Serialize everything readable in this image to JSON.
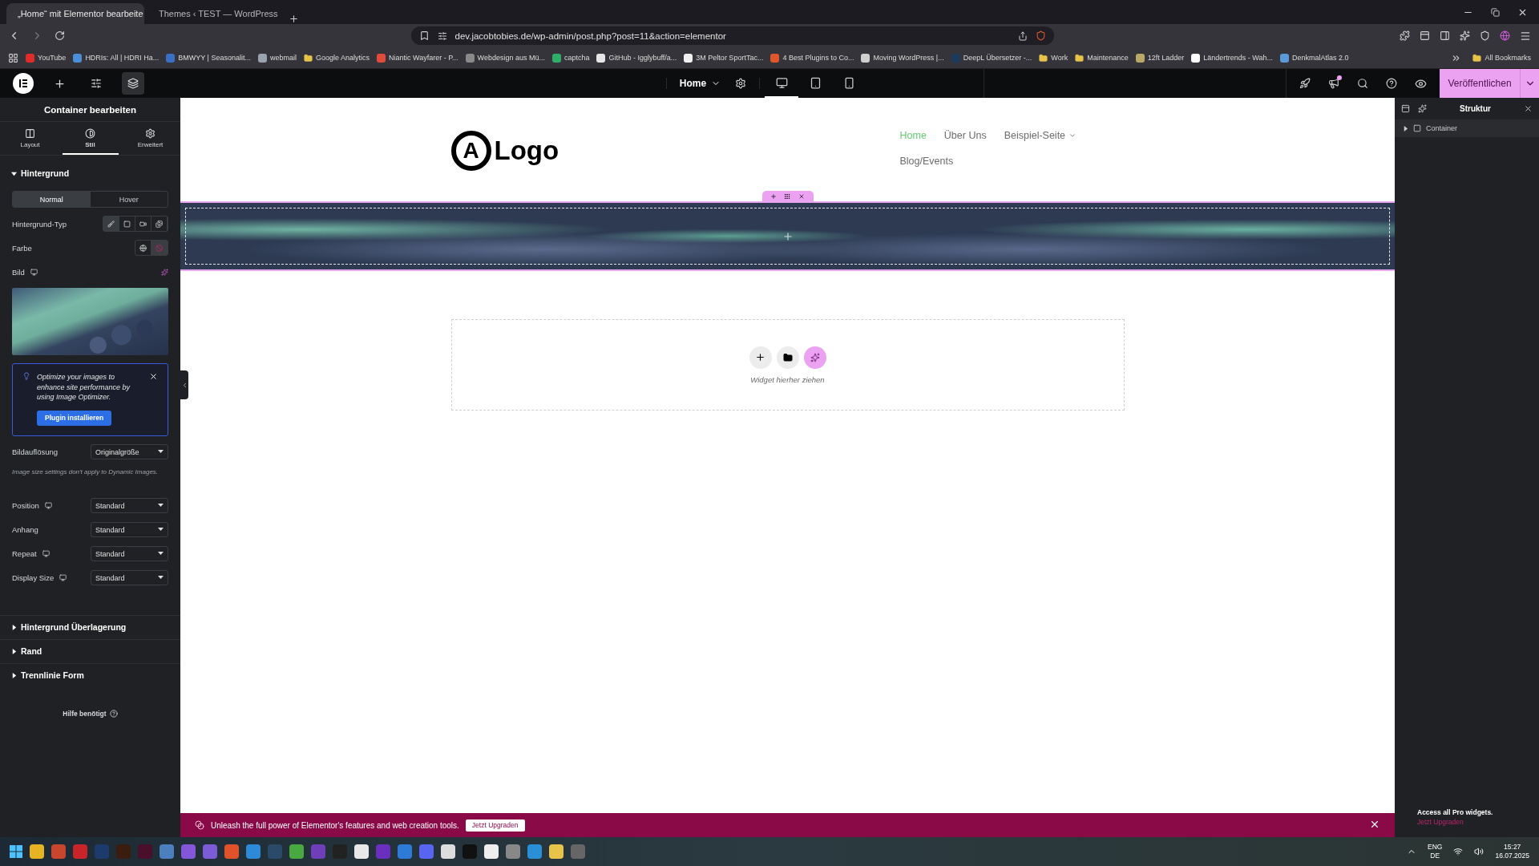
{
  "browser": {
    "tabs": [
      {
        "title": "„Home“ mit Elementor bearbeite",
        "selected": true
      },
      {
        "title": "Themes ‹ TEST — WordPress",
        "selected": false
      }
    ],
    "url": "dev.jacobtobies.de/wp-admin/post.php?post=11&action=elementor",
    "bookmarks": [
      {
        "label": "YouTube",
        "kind": "site",
        "color": "#e02b2b"
      },
      {
        "label": "HDRIs: All | HDRI Ha...",
        "kind": "site",
        "color": "#4a8fd8"
      },
      {
        "label": "BMWYY | Seasonalit...",
        "kind": "site",
        "color": "#3a6fc4"
      },
      {
        "label": "webmail",
        "kind": "site",
        "color": "#9aa4b0"
      },
      {
        "label": "Google Analytics",
        "kind": "folder",
        "color": "#e8c34a"
      },
      {
        "label": "Niantic Wayfarer - P...",
        "kind": "site",
        "color": "#e24b3b"
      },
      {
        "label": "Webdesign aus Mü...",
        "kind": "site",
        "color": "#8a8a8a"
      },
      {
        "label": "captcha",
        "kind": "site",
        "color": "#2fae6a"
      },
      {
        "label": "GitHub - Igglybuff/a...",
        "kind": "site",
        "color": "#e6e6e6"
      },
      {
        "label": "3M Peltor SportTac...",
        "kind": "site",
        "color": "#f0f0f0"
      },
      {
        "label": "4 Best Plugins to Co...",
        "kind": "site",
        "color": "#e0552a"
      },
      {
        "label": "Moving WordPress |...",
        "kind": "site",
        "color": "#cfcfcf"
      },
      {
        "label": "DeepL Übersetzer -...",
        "kind": "site",
        "color": "#1b3a5c"
      },
      {
        "label": "Work",
        "kind": "folder",
        "color": "#e8c34a"
      },
      {
        "label": "Maintenance",
        "kind": "folder",
        "color": "#e8c34a"
      },
      {
        "label": "12ft Ladder",
        "kind": "site",
        "color": "#b8a86a"
      },
      {
        "label": "Ländertrends - Wah...",
        "kind": "site",
        "color": "#ffffff"
      },
      {
        "label": "DenkmalAtlas 2.0",
        "kind": "site",
        "color": "#5a9ad8"
      }
    ],
    "all_bookmarks": "All Bookmarks"
  },
  "editor_bar": {
    "page": "Home",
    "devices": [
      {
        "kind": "desktop",
        "selected": true
      },
      {
        "kind": "tablet",
        "selected": false
      },
      {
        "kind": "mobile",
        "selected": false
      }
    ],
    "notification": true,
    "publish": "Veröffentlichen"
  },
  "panel": {
    "title": "Container bearbeiten",
    "tabs": [
      {
        "label": "Layout",
        "kind": "layout",
        "selected": false
      },
      {
        "label": "Stil",
        "kind": "style",
        "selected": true
      },
      {
        "label": "Erweitert",
        "kind": "advanced",
        "selected": false
      }
    ],
    "section": {
      "title": "Hintergrund",
      "expanded": true
    },
    "states": [
      {
        "label": "Normal",
        "selected": true
      },
      {
        "label": "Hover",
        "selected": false
      }
    ],
    "type_label": "Hintergrund-Typ",
    "types": [
      {
        "kind": "classic",
        "selected": true
      },
      {
        "kind": "gradient",
        "selected": false
      },
      {
        "kind": "video",
        "selected": false
      },
      {
        "kind": "slideshow",
        "selected": false
      }
    ],
    "color_label": "Farbe",
    "image_label": "Bild",
    "notice": {
      "text": "Optimize your images to enhance site performance by using Image Optimizer.",
      "button": "Plugin installieren"
    },
    "resolution": {
      "label": "Bildauflösung",
      "value": "Originalgröße"
    },
    "resolution_note": "Image size settings don't apply to Dynamic Images.",
    "selects": [
      {
        "label": "Position",
        "value": "Standard",
        "responsive": true
      },
      {
        "label": "Anhang",
        "value": "Standard",
        "responsive": false
      },
      {
        "label": "Repeat",
        "value": "Standard",
        "responsive": true
      },
      {
        "label": "Display Size",
        "value": "Standard",
        "responsive": true
      }
    ],
    "collapsed_sections": [
      {
        "title": "Hintergrund Überlagerung",
        "expanded": false
      },
      {
        "title": "Rand",
        "expanded": false
      },
      {
        "title": "Trennlinie Form",
        "expanded": false
      }
    ],
    "help": "Hilfe benötigt"
  },
  "canvas": {
    "logo": {
      "mark": "A",
      "text": "Logo"
    },
    "nav": [
      {
        "label": "Home",
        "selected": true,
        "submenu": false
      },
      {
        "label": "Über Uns",
        "selected": false,
        "submenu": false
      },
      {
        "label": "Beispiel-Seite",
        "selected": false,
        "submenu": true
      },
      {
        "label": "Blog/Events",
        "selected": false,
        "submenu": false
      }
    ],
    "drop_hint": "Widget hierher ziehen"
  },
  "banner": {
    "text": "Unleash the full power of Elementor's features and web creation tools.",
    "button": "Jetzt Upgraden"
  },
  "structure": {
    "title": "Struktur",
    "items": [
      {
        "label": "Container",
        "expanded": false
      }
    ],
    "promo": "Access all Pro widgets.",
    "promo_link": "Jetzt Upgraden"
  },
  "taskbar": {
    "language": "ENG",
    "layout": "DE",
    "time": "15:27",
    "date": "16.07.2025"
  }
}
